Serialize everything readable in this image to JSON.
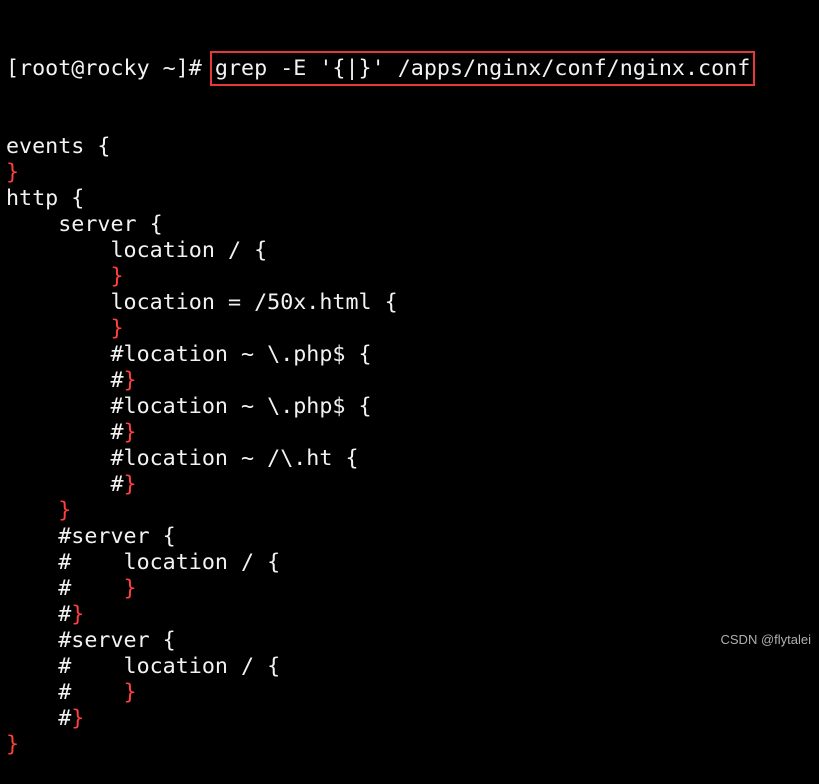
{
  "prompt": "[root@rocky ~]# ",
  "command": "grep -E '{|}' /apps/nginx/conf/nginx.conf",
  "colors": {
    "background": "#000000",
    "text": "#f2f2f2",
    "match": "#ff4040",
    "highlight_box": "#e8373a"
  },
  "output": [
    [
      {
        "t": "events {"
      }
    ],
    [
      {
        "t": "}",
        "r": true
      }
    ],
    [
      {
        "t": "http {"
      }
    ],
    [
      {
        "t": "    server {"
      }
    ],
    [
      {
        "t": "        location / {"
      }
    ],
    [
      {
        "t": "        "
      },
      {
        "t": "}",
        "r": true
      }
    ],
    [
      {
        "t": "        location = /50x.html {"
      }
    ],
    [
      {
        "t": "        "
      },
      {
        "t": "}",
        "r": true
      }
    ],
    [
      {
        "t": "        #location ~ \\.php$ {"
      }
    ],
    [
      {
        "t": "        #"
      },
      {
        "t": "}",
        "r": true
      }
    ],
    [
      {
        "t": "        #location ~ \\.php$ {"
      }
    ],
    [
      {
        "t": "        #"
      },
      {
        "t": "}",
        "r": true
      }
    ],
    [
      {
        "t": "        #location ~ /\\.ht {"
      }
    ],
    [
      {
        "t": "        #"
      },
      {
        "t": "}",
        "r": true
      }
    ],
    [
      {
        "t": "    "
      },
      {
        "t": "}",
        "r": true
      }
    ],
    [
      {
        "t": "    #server {"
      }
    ],
    [
      {
        "t": "    #    location / {"
      }
    ],
    [
      {
        "t": "    #    "
      },
      {
        "t": "}",
        "r": true
      }
    ],
    [
      {
        "t": "    #"
      },
      {
        "t": "}",
        "r": true
      }
    ],
    [
      {
        "t": "    #server {"
      }
    ],
    [
      {
        "t": "    #    location / {"
      }
    ],
    [
      {
        "t": "    #    "
      },
      {
        "t": "}",
        "r": true
      }
    ],
    [
      {
        "t": "    #"
      },
      {
        "t": "}",
        "r": true
      }
    ],
    [
      {
        "t": "}",
        "r": true
      }
    ]
  ],
  "watermark": "CSDN @flytalei"
}
